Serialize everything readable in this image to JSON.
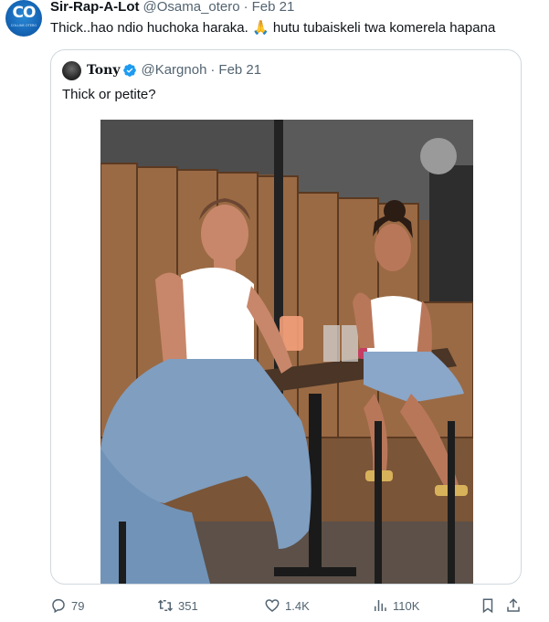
{
  "author": {
    "name": "Sir-Rap-A-Lot",
    "handle": "@Osama_otero",
    "separator": "·",
    "date": "Feb 21",
    "avatar_text": "CO",
    "avatar_subtext": "COLLINS OTERO"
  },
  "tweet": {
    "text": "Thick..hao ndio huchoka haraka. 🙏 hutu tubaiskeli twa komerela hapana"
  },
  "quoted": {
    "name": "Tony",
    "handle": "@Kargnoh",
    "separator": "·",
    "date": "Feb 21",
    "text": "Thick or petite?",
    "verified_color": "#1d9bf0"
  },
  "actions": {
    "reply_count": "79",
    "retweet_count": "351",
    "like_count": "1.4K",
    "views_count": "110K"
  },
  "icons": [
    "reply-icon",
    "retweet-icon",
    "like-icon",
    "views-icon",
    "bookmark-icon",
    "share-icon",
    "verified-icon"
  ],
  "colors": {
    "text": "#0f1419",
    "secondary": "#536471",
    "border": "#cfd9de",
    "accent": "#1d9bf0"
  }
}
